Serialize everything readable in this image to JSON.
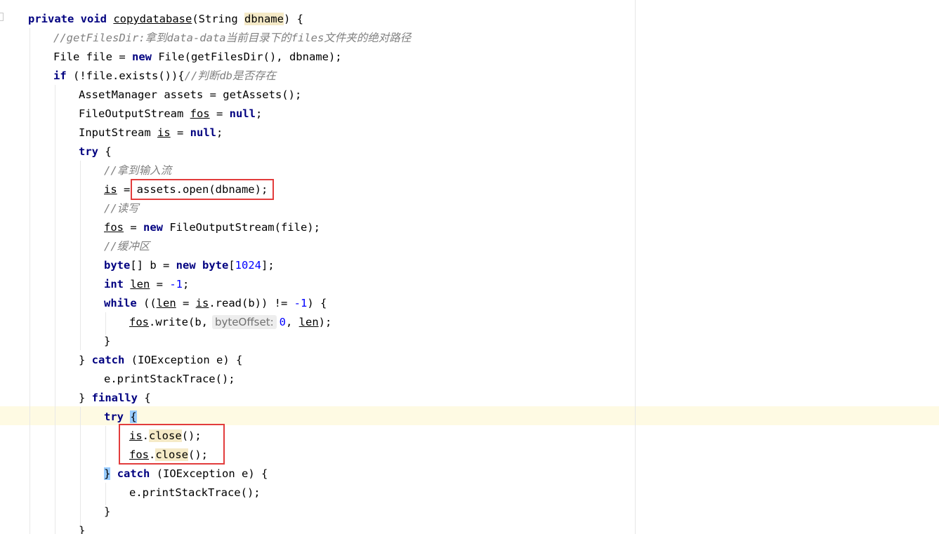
{
  "code": {
    "l1": {
      "kw1": "private",
      "kw2": "void",
      "method": "copydatabase",
      "open": "(String ",
      "param": "dbname",
      "close": ") {"
    },
    "l2": {
      "comment": "//getFilesDir:拿到data-data当前目录下的files文件夹的绝对路径"
    },
    "l3": {
      "t1": "File file = ",
      "kw": "new",
      "t2": " File(getFilesDir(), dbname);"
    },
    "l4": {
      "kw": "if",
      "t1": " (!file.exists()){",
      "comment": "//判断db是否存在"
    },
    "l5": {
      "t1": "AssetManager assets = getAssets();"
    },
    "l6": {
      "t1": "FileOutputStream ",
      "var": "fos",
      "t2": " = ",
      "kw": "null",
      "t3": ";"
    },
    "l7": {
      "t1": "InputStream ",
      "var": "is",
      "t2": " = ",
      "kw": "null",
      "t3": ";"
    },
    "l8": {
      "kw": "try",
      "t1": " {"
    },
    "l9": {
      "comment": "//拿到输入流"
    },
    "l10": {
      "var": "is",
      "t1": " = ",
      "t2": "assets.open(dbname);"
    },
    "l11": {
      "comment": "//读写"
    },
    "l12": {
      "var": "fos",
      "t1": " = ",
      "kw": "new",
      "t2": " FileOutputStream(file);"
    },
    "l13": {
      "comment": "//缓冲区"
    },
    "l14": {
      "kw1": "byte",
      "t1": "[] b = ",
      "kw2": "new",
      "t2": " ",
      "kw3": "byte",
      "t3": "[",
      "num": "1024",
      "t4": "];"
    },
    "l15": {
      "kw": "int",
      "t1": " ",
      "var": "len",
      "t2": " = ",
      "num": "-1",
      "t3": ";"
    },
    "l16": {
      "kw": "while",
      "t1": " ((",
      "var1": "len",
      "t2": " = ",
      "var2": "is",
      "t3": ".read(b)) != ",
      "num": "-1",
      "t4": ") {"
    },
    "l17": {
      "var1": "fos",
      "t1": ".write(b,",
      "hint": "byteOffset:",
      "num": "0",
      "t2": ", ",
      "var2": "len",
      "t3": ");"
    },
    "l18": {
      "t1": "}"
    },
    "l19": {
      "t1": "} ",
      "kw": "catch",
      "t2": " (IOException e) {"
    },
    "l20": {
      "t1": "e.printStackTrace();"
    },
    "l21": {
      "t1": "} ",
      "kw": "finally",
      "t2": " {"
    },
    "l22": {
      "kw": "try",
      "t1": " ",
      "brace": "{"
    },
    "l23": {
      "var": "is",
      "t1": ".",
      "method": "close",
      "t2": "();"
    },
    "l24": {
      "var": "fos",
      "t1": ".",
      "method": "close",
      "t2": "();"
    },
    "l25": {
      "brace": "}",
      "t1": " ",
      "kw": "catch",
      "t2": " (IOException e) {"
    },
    "l26": {
      "t1": "e.printStackTrace();"
    },
    "l27": {
      "t1": "}"
    },
    "l28": {
      "t1": "}"
    }
  },
  "colors": {
    "keyword": "#000080",
    "comment": "#808080",
    "number": "#0000ff",
    "current_line": "#fefae3",
    "annotation_box": "#e23c3c"
  }
}
